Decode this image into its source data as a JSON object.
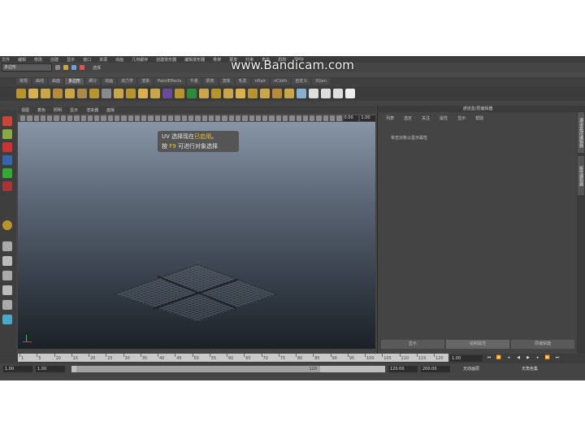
{
  "watermark": "www.Bandicam.com",
  "menubar": [
    "文件",
    "编辑",
    "修改",
    "创建",
    "显示",
    "窗口",
    "资源",
    "动画",
    "几何缓存",
    "创建变形器",
    "编辑变形器",
    "骨架",
    "蒙皮",
    "约束",
    "角色",
    "肌肉",
    "Help"
  ],
  "mode_dropdown": "多边形",
  "search_field": "选择",
  "shelf_tabs": [
    {
      "label": "常规",
      "active": false
    },
    {
      "label": "曲线",
      "active": false
    },
    {
      "label": "曲面",
      "active": false
    },
    {
      "label": "多边形",
      "active": true
    },
    {
      "label": "细分",
      "active": false
    },
    {
      "label": "动画",
      "active": false
    },
    {
      "label": "动力学",
      "active": false
    },
    {
      "label": "渲染",
      "active": false
    },
    {
      "label": "PaintEffects",
      "active": false
    },
    {
      "label": "卡通",
      "active": false
    },
    {
      "label": "肌肉",
      "active": false
    },
    {
      "label": "流体",
      "active": false
    },
    {
      "label": "毛发",
      "active": false
    },
    {
      "label": "nHair",
      "active": false
    },
    {
      "label": "nCloth",
      "active": false
    },
    {
      "label": "自定义",
      "active": false
    },
    {
      "label": "XGen",
      "active": false
    }
  ],
  "viewport_menu": [
    "视图",
    "着色",
    "照明",
    "显示",
    "渲染器",
    "面板"
  ],
  "viewport_fields": [
    "0.00",
    "1.00"
  ],
  "hint": {
    "line1_a": "UV 选择现在",
    "line1_b": "已启用",
    "line1_c": "。",
    "line2_a": "按",
    "line2_b": "F9",
    "line2_c": "可进行对象选择"
  },
  "right_panel": {
    "title": "通道盒/层编辑器",
    "menu": [
      "列表",
      "选定",
      "关注",
      "属性",
      "显示",
      "帮助"
    ],
    "message": "单击对象以显示属性",
    "buttons": [
      "显示",
      "绘制属性",
      "层编辑器"
    ]
  },
  "side_tabs": [
    "通道盒/层编辑器",
    "属性编辑器"
  ],
  "timeline_ticks": [
    "1",
    "5",
    "10",
    "15",
    "20",
    "25",
    "30",
    "35",
    "40",
    "45",
    "50",
    "55",
    "60",
    "65",
    "70",
    "75",
    "80",
    "85",
    "90",
    "95",
    "100",
    "105",
    "110",
    "115",
    "120"
  ],
  "current_frame": "1.00",
  "range": {
    "start": "1.00",
    "inner_start": "1.00",
    "slider_label": "120",
    "inner_end": "120.00",
    "end": "200.00",
    "anim_layer": "无动画层",
    "char_set": "无角色集"
  },
  "colors": {
    "accent": "#f2c230",
    "viewport_top": "#8795a6",
    "viewport_bottom": "#1c2127"
  }
}
